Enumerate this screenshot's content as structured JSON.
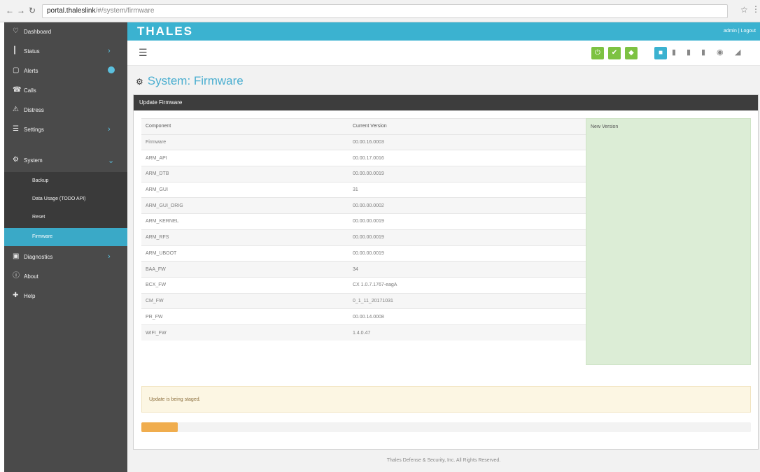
{
  "browser": {
    "url_host": "portal.thaleslink",
    "url_path": "/#/system/firmware"
  },
  "sidebar": {
    "items": [
      {
        "label": "Dashboard",
        "icon": "♡"
      },
      {
        "label": "Status",
        "icon": "┃"
      },
      {
        "label": "Alerts",
        "icon": "▢"
      },
      {
        "label": "Calls",
        "icon": "☎"
      },
      {
        "label": "Distress",
        "icon": "⚠"
      },
      {
        "label": "Settings",
        "icon": "☰"
      },
      {
        "label": "System",
        "icon": "⚙"
      },
      {
        "label": "Diagnostics",
        "icon": "▣"
      },
      {
        "label": "About",
        "icon": "ⓘ"
      },
      {
        "label": "Help",
        "icon": "✚"
      }
    ],
    "sub_items": [
      {
        "label": "Backup"
      },
      {
        "label": "Data Usage (TODO API)"
      },
      {
        "label": "Reset"
      },
      {
        "label": "Firmware"
      }
    ]
  },
  "header": {
    "logo": "THALES",
    "user_text": "admin | Logout"
  },
  "colors": {
    "accent": "#3bb2d0",
    "sidebar": "#4a4a4a",
    "ok_green": "#7dc242",
    "progress": "#f0ad4e"
  },
  "page": {
    "title": "System: Firmware",
    "panel_title": "Update Firmware"
  },
  "table": {
    "headers": [
      "Component",
      "Current Version",
      "New Version"
    ],
    "rows": [
      [
        "Firmware",
        "00.00.16.0003"
      ],
      [
        "ARM_API",
        "00.00.17.0016"
      ],
      [
        "ARM_DTB",
        "00.00.00.0019"
      ],
      [
        "ARM_GUI",
        "31"
      ],
      [
        "ARM_GUI_ORIG",
        "00.00.00.0002"
      ],
      [
        "ARM_KERNEL",
        "00.00.00.0019"
      ],
      [
        "ARM_RFS",
        "00.00.00.0019"
      ],
      [
        "ARM_UBOOT",
        "00.00.00.0019"
      ],
      [
        "BAA_FW",
        "34"
      ],
      [
        "BCX_FW",
        "CX 1.0.7.1767-eagA"
      ],
      [
        "CM_FW",
        "0_1_11_20171031"
      ],
      [
        "PR_FW",
        "00.00.14.0008"
      ],
      [
        "WIFI_FW",
        "1.4.0.47"
      ]
    ]
  },
  "alert": {
    "text": "Update is being staged."
  },
  "progress": {
    "percent": 6
  },
  "footer": {
    "text": "Thales Defense & Security, Inc. All Rights Reserved."
  }
}
